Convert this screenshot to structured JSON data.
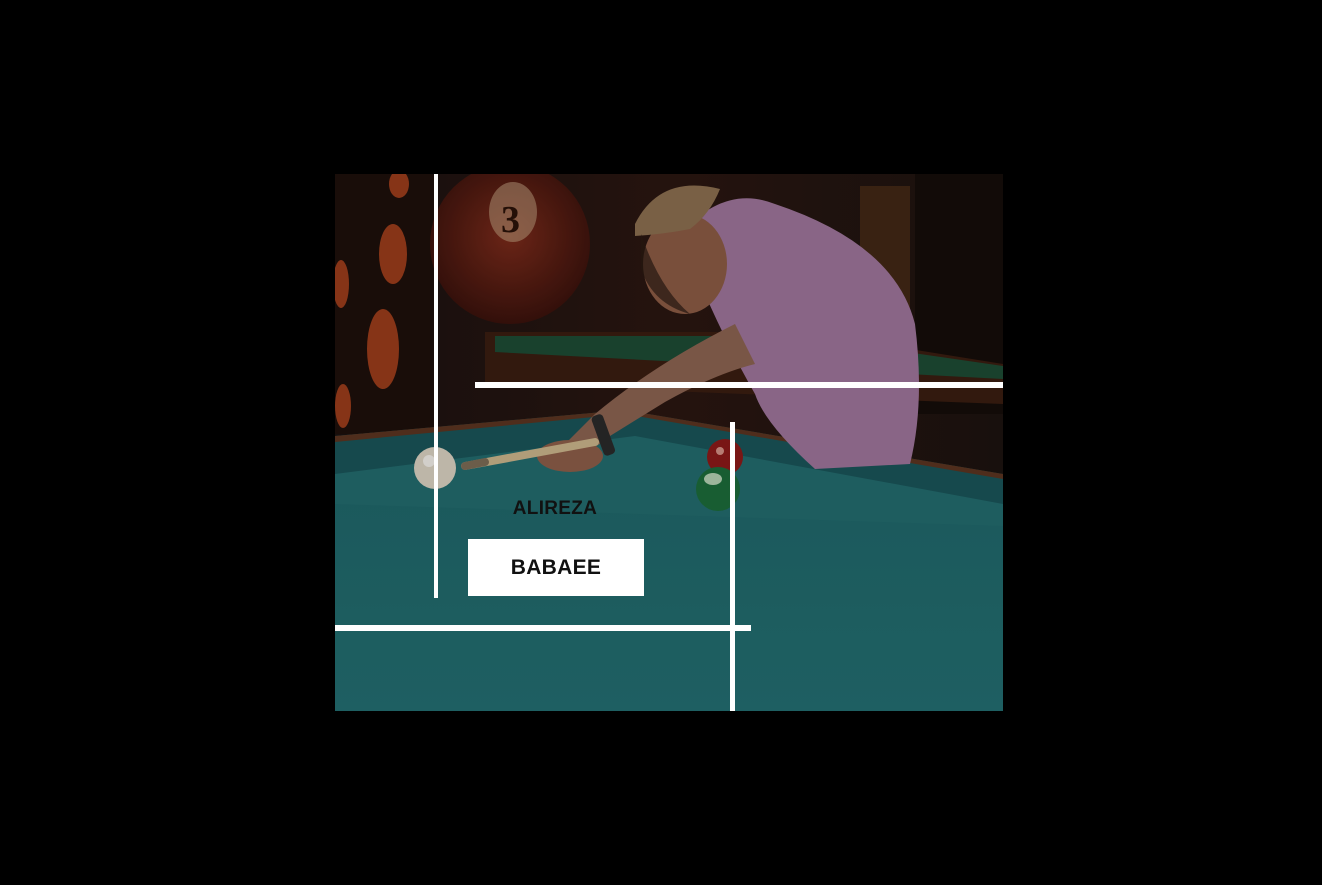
{
  "hero": {
    "first_name": "ALIREZA",
    "last_name": "BABAEE",
    "ball_number": "3"
  },
  "colors": {
    "page_background": "#000000",
    "felt": "#1f6a6c",
    "shirt": "#9a6f97",
    "accent_line": "#ffffff"
  }
}
